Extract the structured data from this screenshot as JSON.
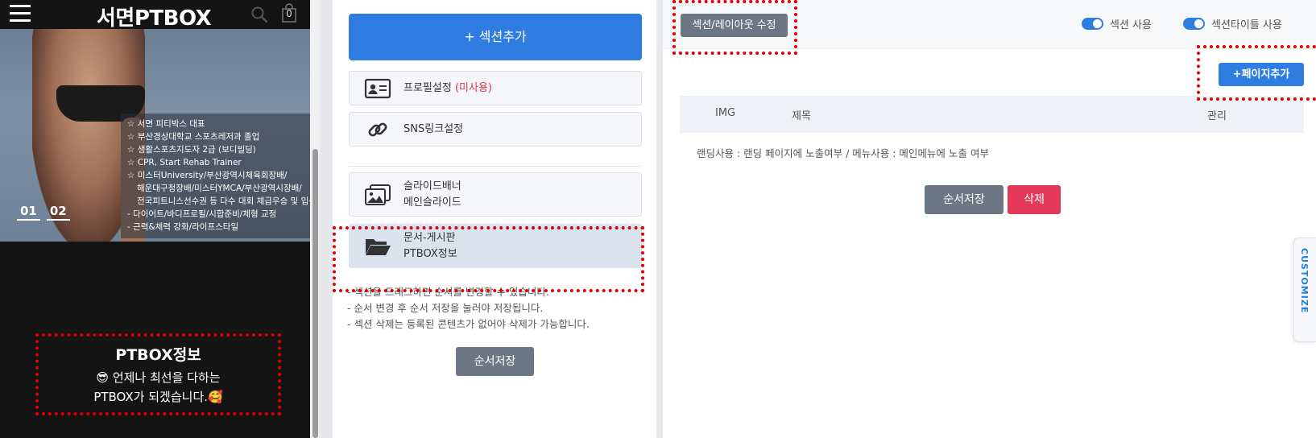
{
  "phone": {
    "site_title": "서면PTBOX",
    "cart_count": "0",
    "hero_lines": [
      "☆ 서면 피티박스 대표",
      "☆ 부산경상대학교 스포츠레저과 졸업",
      "☆ 생활스포츠지도자 2급 (보디빌딩)",
      "☆ CPR, Start Rehab Trainer",
      "☆ 미스터University/부산광역시체육회장배/",
      "    해운대구청장배/미스터YMCA/부산광역시장배/",
      "    전국피트니스선수권 등 다수 대회 체급우승 및 입상",
      "- 다이어트/바디프로필/시합준비/체형 교정",
      "- 근력&체력 강화/라이프스타일"
    ],
    "slide_numbers": [
      "01",
      "02"
    ],
    "section_title": "PTBOX정보",
    "section_line1": "😎 언제나 최선을 다하는",
    "section_line2": "PTBOX가 되겠습니다.🥰"
  },
  "middle": {
    "add_section_label": "+ 섹션추가",
    "profile_label": "프로필설정",
    "profile_status": "(미사용)",
    "sns_label": "SNS링크설정",
    "slider_title": "슬라이드배너",
    "slider_sub": "메인슬라이드",
    "board_title": "문서-게시판",
    "board_sub": "PTBOX정보",
    "notes": [
      "- 섹션을 드래그하면 순서를 변경할 수 있습니다.",
      "- 순서 변경 후 순서 저장을 눌러야 저장됩니다.",
      "- 섹션 삭제는 등록된 콘텐츠가 없어야 삭제가 가능합니다."
    ],
    "order_save_label": "순서저장"
  },
  "right": {
    "layout_edit_label": "섹션/레이아웃 수정",
    "toggle_section_label": "섹션 사용",
    "toggle_title_label": "섹션타이틀 사용",
    "add_page_label": "+페이지추가",
    "columns": {
      "img": "IMG",
      "title": "제목",
      "manage": "관리"
    },
    "note": "랜딩사용 : 랜딩 페이지에 노출여부 / 메뉴사용 : 메인메뉴에 노출 여부",
    "order_save_label": "순서저장",
    "delete_label": "삭제",
    "customize_label": "CUSTOMIZE"
  },
  "colors": {
    "primary": "#2f7de1",
    "secondary": "#6c7785",
    "danger": "#e3385a",
    "highlight": "#e00000"
  },
  "icons": [
    "menu-icon",
    "search-icon",
    "shopping-bag-icon",
    "profile-card-icon",
    "link-icon",
    "images-icon",
    "folder-open-icon"
  ]
}
